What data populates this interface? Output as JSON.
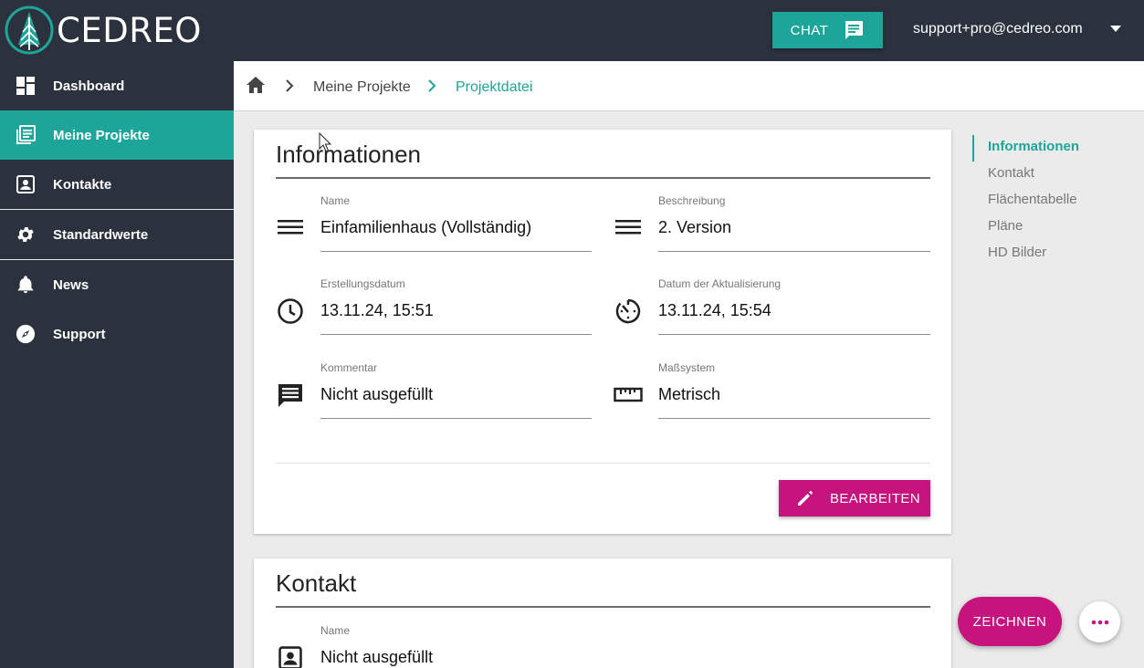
{
  "brand": {
    "name": "CEDREO"
  },
  "header": {
    "chat_label": "CHAT",
    "user_email": "support+pro@cedreo.com"
  },
  "sidebar": {
    "items": [
      {
        "label": "Dashboard",
        "icon": "dashboard-icon",
        "active": false
      },
      {
        "label": "Meine Projekte",
        "icon": "projects-icon",
        "active": true
      },
      {
        "label": "Kontakte",
        "icon": "contact-card-icon",
        "active": false
      },
      {
        "label": "Standardwerte",
        "icon": "gear-icon",
        "active": false
      },
      {
        "label": "News",
        "icon": "bell-icon",
        "active": false
      },
      {
        "label": "Support",
        "icon": "compass-icon",
        "active": false
      }
    ]
  },
  "breadcrumb": {
    "parent": "Meine Projekte",
    "current": "Projektdatei"
  },
  "info_card": {
    "title": "Informationen",
    "fields": [
      {
        "label": "Name",
        "value": "Einfamilienhaus (Vollständig)",
        "icon": "lines-icon"
      },
      {
        "label": "Beschreibung",
        "value": "2. Version",
        "icon": "lines-icon"
      },
      {
        "label": "Erstellungsdatum",
        "value": "13.11.24, 15:51",
        "icon": "clock-icon"
      },
      {
        "label": "Datum der Aktualisierung",
        "value": "13.11.24, 15:54",
        "icon": "timer-icon"
      },
      {
        "label": "Kommentar",
        "value": "Nicht ausgefüllt",
        "icon": "comment-icon"
      },
      {
        "label": "Maßsystem",
        "value": "Metrisch",
        "icon": "ruler-icon"
      }
    ],
    "edit_label": "BEARBEITEN"
  },
  "contact_card": {
    "title": "Kontakt",
    "fields": [
      {
        "label": "Name",
        "value": "Nicht ausgefüllt",
        "icon": "contact-card-icon"
      }
    ]
  },
  "toc": {
    "items": [
      "Informationen",
      "Kontakt",
      "Flächentabelle",
      "Pläne",
      "HD Bilder"
    ]
  },
  "fab": {
    "draw_label": "ZEICHNEN"
  },
  "colors": {
    "teal": "#1ea59a",
    "magenta": "#c6137d",
    "dark": "#2b313d"
  }
}
